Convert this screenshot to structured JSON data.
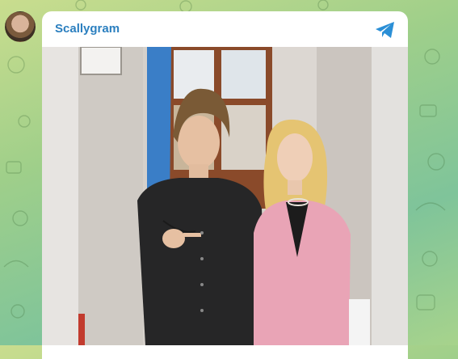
{
  "channel": {
    "name": "Scallygram",
    "send_icon": "telegram-plane-icon",
    "accent_color": "#2b7fbf"
  },
  "post": {
    "media_type": "photo",
    "icon": "photo-icon"
  }
}
